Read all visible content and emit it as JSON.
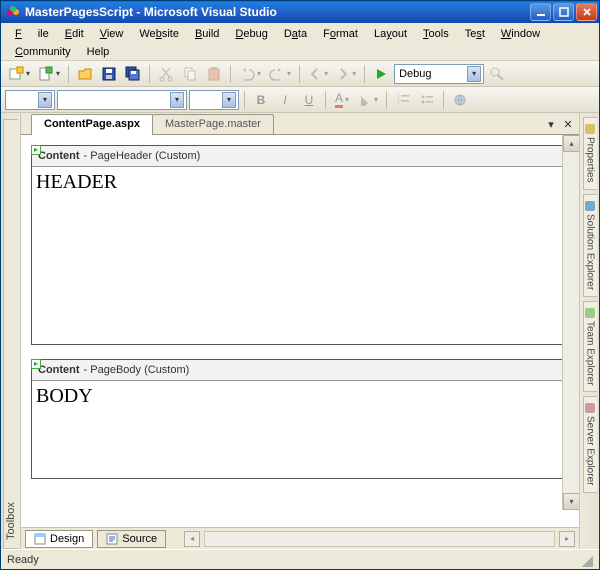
{
  "titlebar": {
    "title": "MasterPagesScript - Microsoft Visual Studio"
  },
  "menu": {
    "file": "File",
    "edit": "Edit",
    "view": "View",
    "website": "Website",
    "build": "Build",
    "debug": "Debug",
    "data": "Data",
    "format": "Format",
    "layout": "Layout",
    "tools": "Tools",
    "test": "Test",
    "window": "Window",
    "community": "Community",
    "help": "Help"
  },
  "toolbar": {
    "config_label": "Debug"
  },
  "tabs": {
    "active": "ContentPage.aspx",
    "other": "MasterPage.master"
  },
  "left_tool_tab": "Toolbox",
  "right_tabs": [
    "Properties",
    "Solution Explorer",
    "Team Explorer",
    "Server Explorer"
  ],
  "regions": {
    "header": {
      "label_strong": "Content",
      "label_rest": " - PageHeader (Custom)",
      "text": "HEADER"
    },
    "body": {
      "label_strong": "Content",
      "label_rest": " - PageBody (Custom)",
      "text": "BODY"
    }
  },
  "viewtabs": {
    "design": "Design",
    "source": "Source"
  },
  "status": "Ready"
}
